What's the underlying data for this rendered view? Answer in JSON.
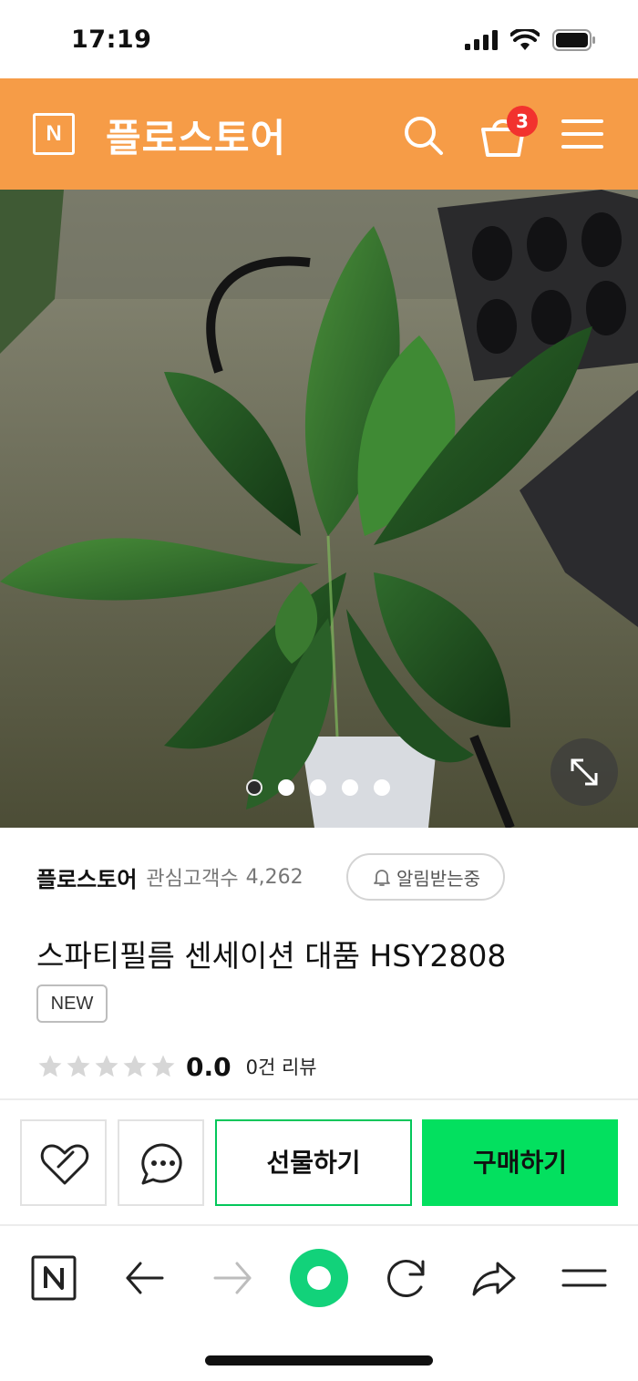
{
  "status_bar": {
    "time": "17:19"
  },
  "header": {
    "logo_letter": "N",
    "store_name": "플로스토어",
    "cart_count": "3",
    "icons": [
      "search-icon",
      "cart-icon",
      "menu-icon"
    ],
    "background_color": "#f69c47"
  },
  "gallery": {
    "image_description": "photo-of-spathiphyllum-plant",
    "total_slides": 5,
    "current_slide": 1
  },
  "seller": {
    "name": "플로스토어",
    "follow_label": "관심고객수",
    "follow_count": "4,262",
    "notify_label": "알림받는중"
  },
  "product": {
    "title": "스파티필름 센세이션 대품 HSY2808",
    "badge": "NEW",
    "rating": "0.0",
    "stars": 0,
    "review_count": "0건 리뷰"
  },
  "actions": {
    "gift_label": "선물하기",
    "buy_label": "구매하기",
    "buy_color": "#03e05f",
    "accent_color": "#03c75a"
  },
  "browser_nav": {
    "logo_letter": "N",
    "icons": [
      "naver-home-icon",
      "back-arrow-icon",
      "forward-arrow-icon",
      "green-dot-icon",
      "refresh-icon",
      "share-icon",
      "menu-icon"
    ]
  }
}
